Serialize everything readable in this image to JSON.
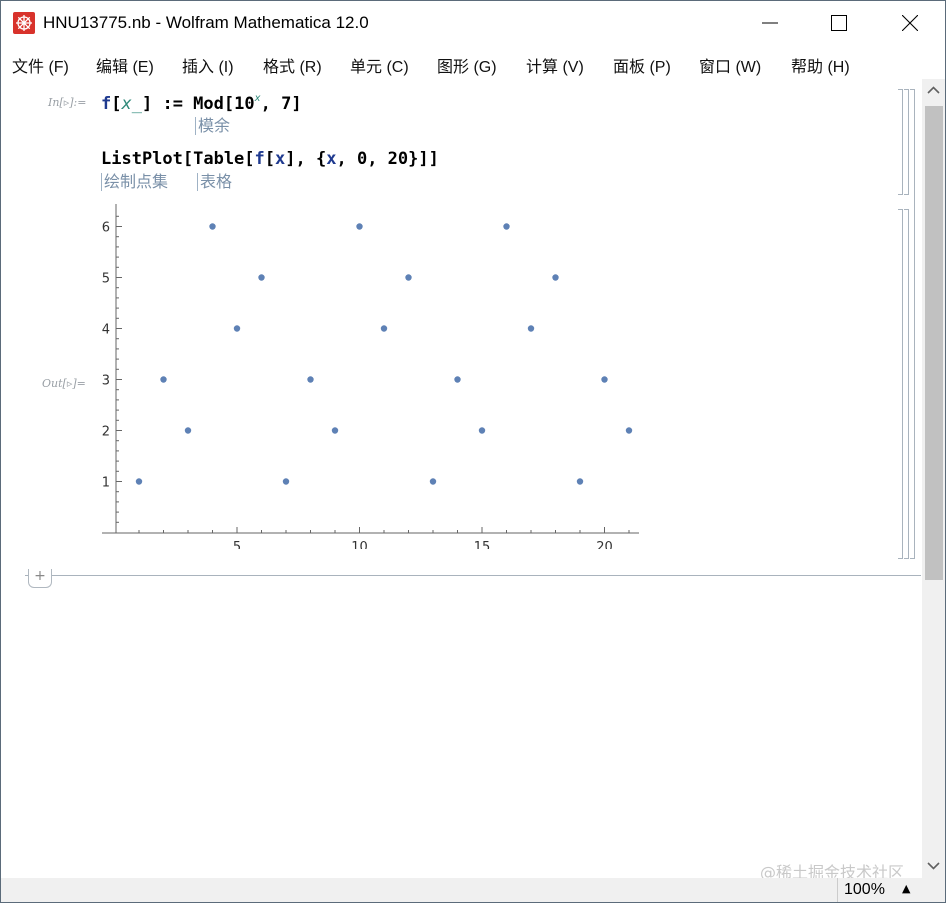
{
  "window": {
    "title": "HNU13775.nb - Wolfram Mathematica 12.0"
  },
  "menu": [
    "文件 (F)",
    "编辑 (E)",
    "插入 (I)",
    "格式 (R)",
    "单元 (C)",
    "图形 (G)",
    "计算 (V)",
    "面板 (P)",
    "窗口 (W)",
    "帮助 (H)"
  ],
  "cells": {
    "in_label": "In[▹]:=",
    "out_label": "Out[▹]=",
    "line1": {
      "f": "f",
      "args_open": "[",
      "x": "x_",
      "args_close": "]",
      "assign": " := Mod[10",
      "exp": "x",
      "rest": ", 7]"
    },
    "line1_hint": "模余",
    "line2": {
      "a": "ListPlot[Table[",
      "f": "f",
      "b": "[",
      "x": "x",
      "c": "], {",
      "x2": "x",
      "d": ", 0, 20}]]"
    },
    "line2_hints": [
      "绘制点集",
      "表格"
    ]
  },
  "chart_data": {
    "type": "scatter",
    "x": [
      1,
      2,
      3,
      4,
      5,
      6,
      7,
      8,
      9,
      10,
      11,
      12,
      13,
      14,
      15,
      16,
      17,
      18,
      19,
      20,
      21
    ],
    "y": [
      1,
      3,
      2,
      6,
      4,
      5,
      1,
      3,
      2,
      6,
      4,
      5,
      1,
      3,
      2,
      6,
      4,
      5,
      1,
      3,
      2
    ],
    "xticks": [
      5,
      10,
      15,
      20
    ],
    "yticks": [
      1,
      2,
      3,
      4,
      5,
      6
    ],
    "xlim": [
      0.5,
      21.5
    ],
    "ylim": [
      0,
      6.3
    ],
    "point_color": "#5e81b5"
  },
  "statusbar": {
    "zoom": "100%"
  },
  "watermark": "@稀土掘金技术社区"
}
